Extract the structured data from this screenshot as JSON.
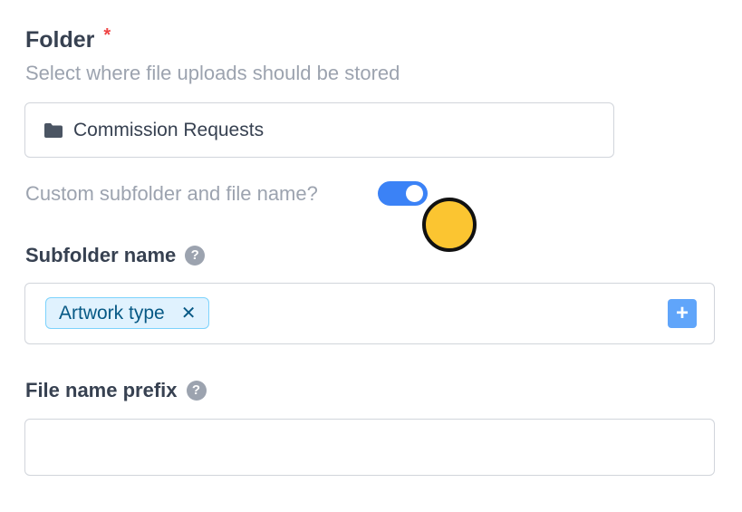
{
  "folder": {
    "title": "Folder",
    "required_mark": "*",
    "help_text": "Select where file uploads should be stored",
    "value": "Commission Requests",
    "icon": "folder-icon"
  },
  "custom_toggle": {
    "label": "Custom subfolder and file name?",
    "enabled": true,
    "color": "#3b82f6"
  },
  "subfolder": {
    "label": "Subfolder name",
    "help_icon": "?",
    "tokens": [
      {
        "label": "Artwork type",
        "remove_glyph": "✕"
      }
    ],
    "add_glyph": "+"
  },
  "file_name_prefix": {
    "label": "File name prefix",
    "help_icon": "?",
    "value": "",
    "placeholder": ""
  },
  "colors": {
    "accent": "#3b82f6",
    "required": "#ef4444",
    "token_bg": "#e0f2fe",
    "cursor_marker": "#fbc531"
  }
}
